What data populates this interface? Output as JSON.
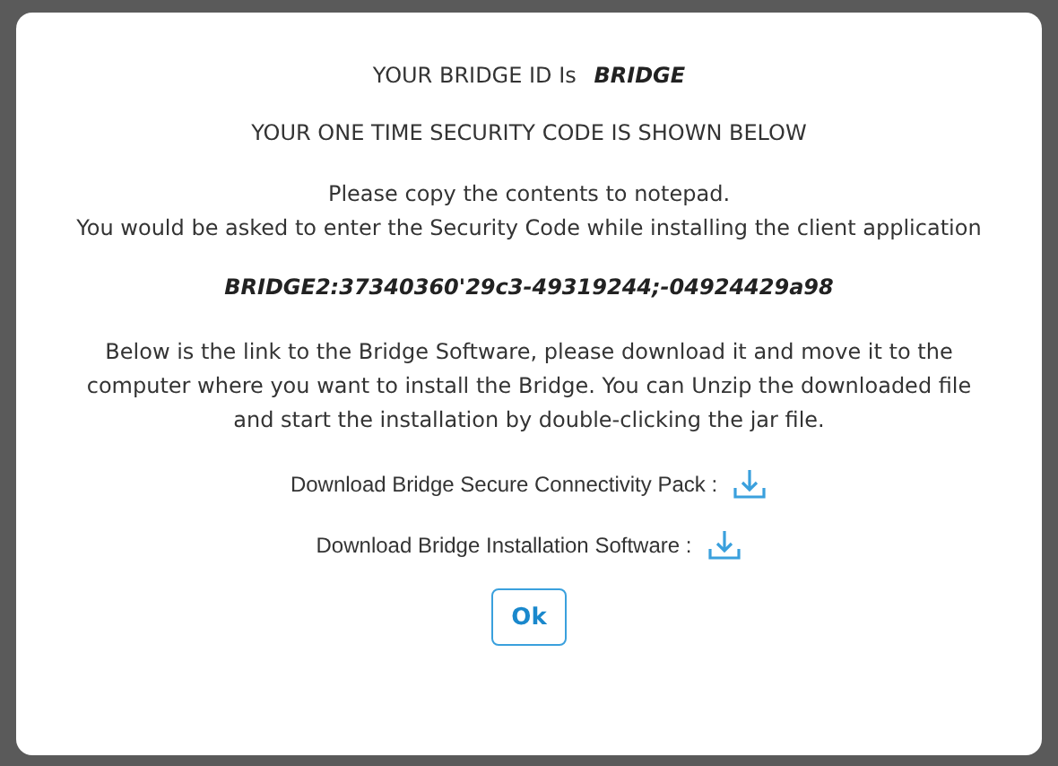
{
  "bridge_id_label": "YOUR BRIDGE ID Is",
  "bridge_id": "BRIDGE",
  "code_heading": "YOUR ONE TIME SECURITY CODE IS SHOWN BELOW",
  "instructions": [
    "Please copy the contents to notepad.",
    "You would be asked to enter the Security Code while installing the client application"
  ],
  "security_code": "BRIDGE2:37340360'29c3-49319244;-04924429a98",
  "download_note": "Below is the link to the Bridge Software, please download it and move it to the computer where you want to install the Bridge. You can Unzip the downloaded file and start the installation by double-clicking the jar file.",
  "downloads": [
    {
      "label": "Download Bridge Secure Connectivity Pack :"
    },
    {
      "label": "Download Bridge Installation Software :"
    }
  ],
  "ok_button": "Ok"
}
